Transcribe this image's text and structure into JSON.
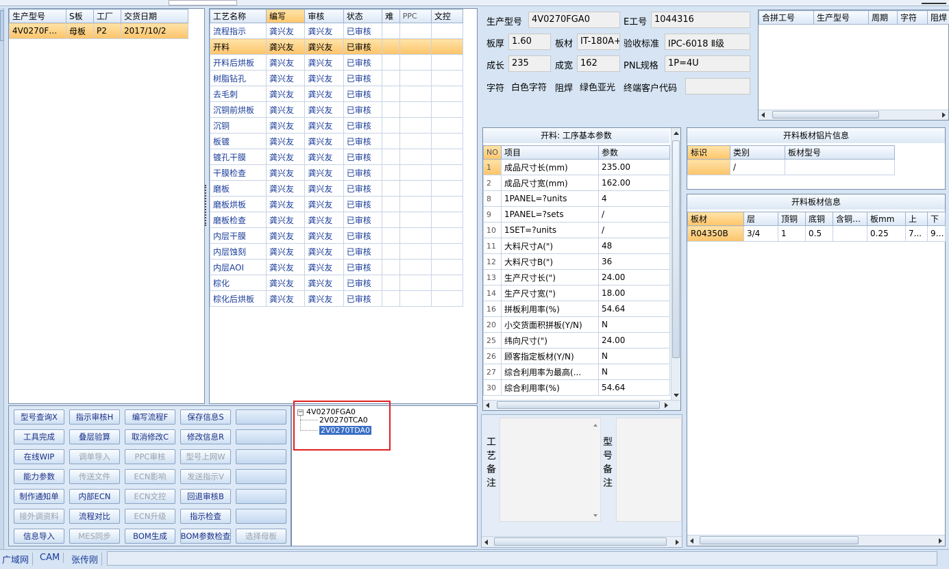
{
  "menubar": {
    "partial_text": "…"
  },
  "order_table": {
    "headers": [
      "生产型号",
      "S板",
      "工厂",
      "交货日期"
    ],
    "rows": [
      [
        "4V0270FGA0",
        "母板",
        "P2",
        "2017/10/2"
      ]
    ]
  },
  "process_table": {
    "headers": [
      "工艺名称",
      "编写",
      "审核",
      "状态",
      "难",
      "PPC",
      "文控"
    ],
    "rows": [
      [
        "流程指示",
        "龚兴友",
        "龚兴友",
        "已审核"
      ],
      [
        "开料",
        "龚兴友",
        "龚兴友",
        "已审核"
      ],
      [
        "开料后烘板",
        "龚兴友",
        "龚兴友",
        "已审核"
      ],
      [
        "树脂钻孔",
        "龚兴友",
        "龚兴友",
        "已审核"
      ],
      [
        "去毛刺",
        "龚兴友",
        "龚兴友",
        "已审核"
      ],
      [
        "沉铜前烘板",
        "龚兴友",
        "龚兴友",
        "已审核"
      ],
      [
        "沉铜",
        "龚兴友",
        "龚兴友",
        "已审核"
      ],
      [
        "板镀",
        "龚兴友",
        "龚兴友",
        "已审核"
      ],
      [
        "镀孔干膜",
        "龚兴友",
        "龚兴友",
        "已审核"
      ],
      [
        "干膜检查",
        "龚兴友",
        "龚兴友",
        "已审核"
      ],
      [
        "磨板",
        "龚兴友",
        "龚兴友",
        "已审核"
      ],
      [
        "磨板烘板",
        "龚兴友",
        "龚兴友",
        "已审核"
      ],
      [
        "磨板检查",
        "龚兴友",
        "龚兴友",
        "已审核"
      ],
      [
        "内层干膜",
        "龚兴友",
        "龚兴友",
        "已审核"
      ],
      [
        "内层蚀刻",
        "龚兴友",
        "龚兴友",
        "已审核"
      ],
      [
        "内层AOI",
        "龚兴友",
        "龚兴友",
        "已审核"
      ],
      [
        "棕化",
        "龚兴友",
        "龚兴友",
        "已审核"
      ],
      [
        "棕化后烘板",
        "龚兴友",
        "龚兴友",
        "已审核"
      ]
    ]
  },
  "buttons": [
    {
      "label": "型号查询X",
      "enabled": true
    },
    {
      "label": "指示审核H",
      "enabled": true
    },
    {
      "label": "编写流程F",
      "enabled": true
    },
    {
      "label": "保存信息S",
      "enabled": true
    },
    {
      "label": "",
      "enabled": true
    },
    {
      "label": "工具完成",
      "enabled": true
    },
    {
      "label": "叠层验算",
      "enabled": true
    },
    {
      "label": "取消修改C",
      "enabled": true
    },
    {
      "label": "修改信息R",
      "enabled": true
    },
    {
      "label": "",
      "enabled": true
    },
    {
      "label": "在线WIP",
      "enabled": true
    },
    {
      "label": "调单导入",
      "enabled": false
    },
    {
      "label": "PPC审核",
      "enabled": false
    },
    {
      "label": "型号上网W",
      "enabled": false
    },
    {
      "label": "",
      "enabled": true
    },
    {
      "label": "能力参数",
      "enabled": true
    },
    {
      "label": "传送文件",
      "enabled": false
    },
    {
      "label": "ECN影响",
      "enabled": false
    },
    {
      "label": "发送指示V",
      "enabled": false
    },
    {
      "label": "",
      "enabled": true
    },
    {
      "label": "制作通知单",
      "enabled": true
    },
    {
      "label": "内部ECN",
      "enabled": true
    },
    {
      "label": "ECN文控",
      "enabled": false
    },
    {
      "label": "回退审核B",
      "enabled": true
    },
    {
      "label": "",
      "enabled": true
    },
    {
      "label": "接外调资料",
      "enabled": false
    },
    {
      "label": "流程对比",
      "enabled": true
    },
    {
      "label": "ECN升级",
      "enabled": false
    },
    {
      "label": "指示检查",
      "enabled": true
    },
    {
      "label": "",
      "enabled": true
    },
    {
      "label": "信息导入",
      "enabled": true
    },
    {
      "label": "MES同步",
      "enabled": false
    },
    {
      "label": "BOM生成",
      "enabled": true
    },
    {
      "label": "BOM参数检查",
      "enabled": true
    },
    {
      "label": "选择母板",
      "enabled": false
    }
  ],
  "tree": {
    "root": "4V0270FGA0",
    "children": [
      "2V0270TCA0",
      "2V0270TDA0"
    ]
  },
  "info": {
    "model_label": "生产型号",
    "model_value": "4V0270FGA0",
    "eno_label": "E工号",
    "eno_value": "1044316",
    "thickness_label": "板厚",
    "thickness_value": "1.60",
    "material_label": "板材",
    "material_value": "IT-180A+",
    "standard_label": "验收标准",
    "standard_value": "IPC-6018 Ⅱ级",
    "length_label": "成长",
    "length_value": "235",
    "width_label": "成宽",
    "width_value": "162",
    "pnl_label": "PNL规格",
    "pnl_value": "1P=4U",
    "char_label": "字符",
    "char_value": "白色字符",
    "mask_label": "阻焊",
    "mask_value": "绿色亚光",
    "customer_label": "终端客户代码",
    "customer_value": ""
  },
  "merge_table": {
    "headers": [
      "合拼工号",
      "生产型号",
      "周期",
      "字符",
      "阻焊"
    ]
  },
  "params": {
    "title": "开料: 工序基本参数",
    "headers": [
      "NO",
      "项目",
      "参数"
    ],
    "rows": [
      [
        "1",
        "成品尺寸长(mm)",
        "235.00"
      ],
      [
        "2",
        "成品尺寸宽(mm)",
        "162.00"
      ],
      [
        "8",
        "1PANEL=?units",
        "4"
      ],
      [
        "9",
        "1PANEL=?sets",
        "/"
      ],
      [
        "10",
        "1SET=?units",
        "/"
      ],
      [
        "11",
        "大料尺寸A(\")",
        "48"
      ],
      [
        "12",
        "大料尺寸B(\")",
        "36"
      ],
      [
        "13",
        "生产尺寸长(\")",
        "24.00"
      ],
      [
        "14",
        "生产尺寸宽(\")",
        "18.00"
      ],
      [
        "16",
        "拼板利用率(%)",
        "54.64"
      ],
      [
        "20",
        "小交货面积拼板(Y/N)",
        "N"
      ],
      [
        "25",
        "纬向尺寸(\")",
        "24.00"
      ],
      [
        "26",
        "顾客指定板材(Y/N)",
        "N"
      ],
      [
        "27",
        "综合利用率为最高(...",
        "N"
      ],
      [
        "30",
        "综合利用率(%)",
        "54.64"
      ]
    ]
  },
  "al_info": {
    "title": "开料板材铝片信息",
    "headers": [
      "标识",
      "类别",
      "板材型号"
    ],
    "row": [
      "",
      "/",
      ""
    ]
  },
  "board_info": {
    "title": "开料板材信息",
    "headers": [
      "板材",
      "层",
      "顶铜",
      "底铜",
      "含铜mm",
      "板mm",
      "上",
      "下"
    ],
    "row": [
      "R04350B",
      "3/4",
      "1",
      "0.5",
      "",
      "0.25",
      "7...",
      "9..."
    ]
  },
  "notes": {
    "process_note_label": "工艺备注",
    "model_note_label": "型号备注"
  },
  "statusbar": {
    "items": [
      "广域网",
      "CAM",
      "张传刚"
    ]
  }
}
